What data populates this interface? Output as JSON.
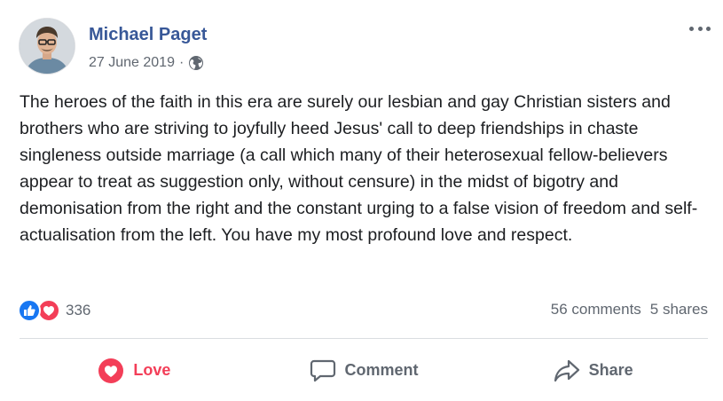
{
  "post": {
    "author": "Michael Paget",
    "date": "27 June 2019",
    "separator": "·",
    "privacy_icon": "globe-icon",
    "body": "The heroes of the faith in this era are surely our lesbian and gay Christian sisters and brothers who are striving to joyfully heed Jesus' call to deep friendships in chaste singleness outside marriage (a call which many of their heterosexual fellow-believers appear to treat as suggestion only, without censure) in the midst of bigotry and demonisation from the right and the constant urging to a false vision of freedom and self-actualisation from the left. You have my most profound love and respect."
  },
  "reactions": {
    "count": "336",
    "icons": [
      "like-icon",
      "love-icon"
    ]
  },
  "stats": {
    "comments": "56 comments",
    "shares": "5 shares"
  },
  "actions": {
    "love_label": "Love",
    "comment_label": "Comment",
    "share_label": "Share"
  },
  "colors": {
    "author_link": "#385898",
    "secondary_text": "#606770",
    "like_blue": "#1877f2",
    "love_red": "#f33e58"
  }
}
